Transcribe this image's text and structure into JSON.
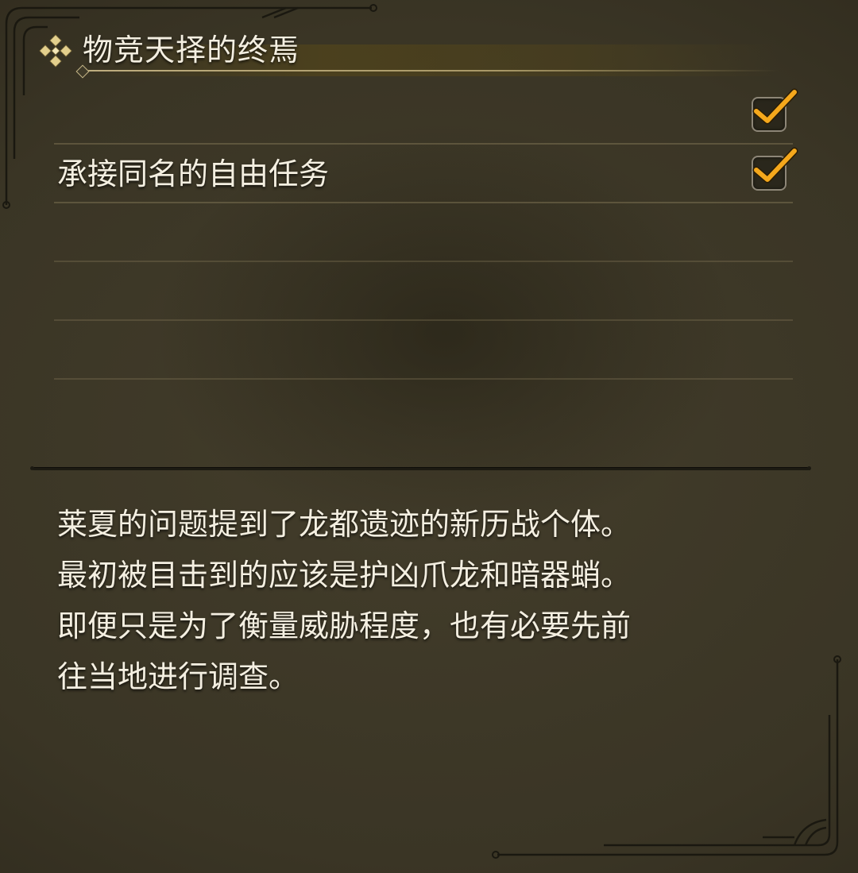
{
  "quest": {
    "title": "物竞天择的终焉",
    "emblem_icon": "ornate-diamond-icon"
  },
  "objectives": [
    {
      "label": "",
      "completed": true
    },
    {
      "label": "承接同名的自由任务",
      "completed": true
    },
    {
      "label": "",
      "completed": false
    },
    {
      "label": "",
      "completed": false
    },
    {
      "label": "",
      "completed": false
    }
  ],
  "description": {
    "lines": [
      "莱夏的问题提到了龙都遗迹的新历战个体。",
      "最初被目击到的应该是护凶爪龙和暗器蛸。",
      "即便只是为了衡量威胁程度，也有必要先前",
      "往当地进行调查。"
    ]
  },
  "colors": {
    "background": "#3f3a29",
    "text": "#f4efe1",
    "accent_gold": "#c9b98a",
    "check_orange": "#f5a81c"
  }
}
